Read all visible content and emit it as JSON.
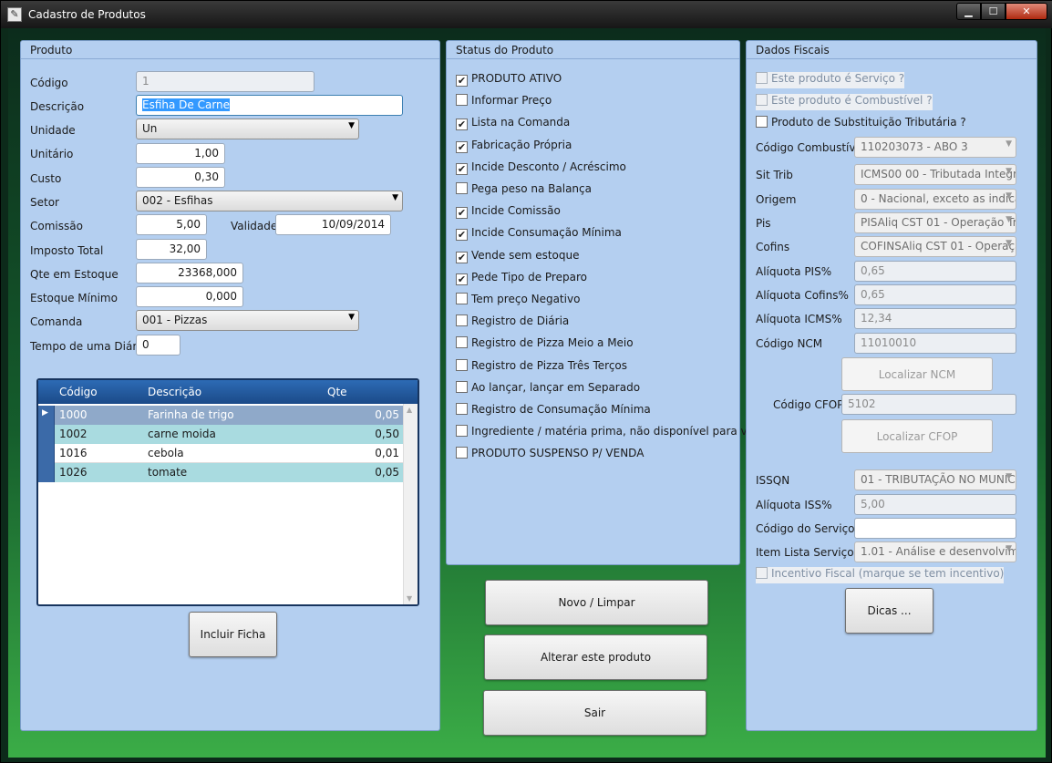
{
  "window": {
    "title": "Cadastro de Produtos",
    "icon": "pencil-icon",
    "controls": {
      "minimize": "▁",
      "maximize": "☐",
      "close": "✕"
    }
  },
  "produto": {
    "section_title": "Produto",
    "codigo": {
      "label": "Código",
      "value": "1"
    },
    "descricao": {
      "label": "Descrição",
      "value": "Esfiha De Carne"
    },
    "unidade": {
      "label": "Unidade",
      "value": "Un"
    },
    "unitario": {
      "label": "Unitário",
      "value": "1,00"
    },
    "custo": {
      "label": "Custo",
      "value": "0,30"
    },
    "setor": {
      "label": "Setor",
      "value": "002 - Esfihas"
    },
    "comissao": {
      "label": "Comissão",
      "value": "5,00"
    },
    "validade": {
      "label": "Validade",
      "value": "10/09/2014"
    },
    "imposto_total": {
      "label": "Imposto Total",
      "value": "32,00"
    },
    "qte_estoque": {
      "label": "Qte em Estoque",
      "value": "23368,000"
    },
    "estoque_minimo": {
      "label": "Estoque Mínimo",
      "value": "0,000"
    },
    "comanda": {
      "label": "Comanda",
      "value": "001 - Pizzas"
    },
    "tempo_diaria": {
      "label": "Tempo de uma Diária",
      "value": "0"
    },
    "ficha": {
      "columns": [
        "Código",
        "Descrição",
        "Qte"
      ],
      "rows": [
        {
          "codigo": "1000",
          "descricao": "Farinha de trigo",
          "qte": "0,05"
        },
        {
          "codigo": "1002",
          "descricao": "carne moida",
          "qte": "0,50"
        },
        {
          "codigo": "1016",
          "descricao": "cebola",
          "qte": "0,01"
        },
        {
          "codigo": "1026",
          "descricao": "tomate",
          "qte": "0,05"
        }
      ]
    },
    "incluir_ficha_label": "Incluir Ficha"
  },
  "status": {
    "section_title": "Status do Produto",
    "items": [
      {
        "label": "PRODUTO ATIVO",
        "checked": true
      },
      {
        "label": "Informar Preço",
        "checked": false
      },
      {
        "label": "Lista na Comanda",
        "checked": true
      },
      {
        "label": "Fabricação Própria",
        "checked": true
      },
      {
        "label": "Incide Desconto / Acréscimo",
        "checked": true
      },
      {
        "label": "Pega peso na Balança",
        "checked": false
      },
      {
        "label": "Incide Comissão",
        "checked": true
      },
      {
        "label": "Incide Consumação Mínima",
        "checked": true
      },
      {
        "label": "Vende sem estoque",
        "checked": true
      },
      {
        "label": "Pede Tipo de Preparo",
        "checked": true
      },
      {
        "label": "Tem preço Negativo",
        "checked": false
      },
      {
        "label": "Registro de Diária",
        "checked": false
      },
      {
        "label": "Registro de Pizza Meio a Meio",
        "checked": false
      },
      {
        "label": "Registro de Pizza Três Terços",
        "checked": false
      },
      {
        "label": "Ao lançar, lançar em Separado",
        "checked": false
      },
      {
        "label": "Registro de Consumação Mínima",
        "checked": false
      },
      {
        "label": "Ingrediente / matéria prima, não disponível para venda",
        "checked": false
      },
      {
        "label": "PRODUTO SUSPENSO P/ VENDA",
        "checked": false
      }
    ]
  },
  "actions": {
    "novo_label": "Novo / Limpar",
    "alterar_label": "Alterar este produto",
    "sair_label": "Sair"
  },
  "fiscal": {
    "section_title": "Dados Fiscais",
    "servico_label": "Este produto é Serviço ?",
    "combustivel_label": "Este produto é Combustível ?",
    "subst_label": "Produto de Substituição Tributária ?",
    "cod_combustivel": {
      "label": "Código Combustível",
      "value": "110203073 - ABO 3"
    },
    "sit_trib": {
      "label": "Sit Trib",
      "value": "ICMS00 00 - Tributada Integr"
    },
    "origem": {
      "label": "Origem",
      "value": "0 - Nacional, exceto as indica"
    },
    "pis": {
      "label": "Pis",
      "value": "PISAliq CST 01 - Operação Tri"
    },
    "cofins": {
      "label": "Cofins",
      "value": "COFINSAliq CST 01 - Operaçã"
    },
    "aliq_pis": {
      "label": "Alíquota PIS%",
      "value": "0,65"
    },
    "aliq_cofins": {
      "label": "Alíquota Cofins%",
      "value": "0,65"
    },
    "aliq_icms": {
      "label": "Alíquota ICMS%",
      "value": "12,34"
    },
    "ncm": {
      "label": "Código NCM",
      "value": "11010010"
    },
    "localizar_ncm_label": "Localizar NCM",
    "cfop": {
      "label": "Código CFOP",
      "value": "5102"
    },
    "localizar_cfop_label": "Localizar CFOP",
    "issqn": {
      "label": "ISSQN",
      "value": "01 - TRIBUTAÇÃO NO MUNIC"
    },
    "aliq_iss": {
      "label": "Alíquota ISS%",
      "value": "5,00"
    },
    "cod_servico": {
      "label": "Código do Serviço",
      "value": ""
    },
    "item_lista": {
      "label": "Item Lista Serviço",
      "value": "1.01 - Análise e desenvolvime"
    },
    "incentivo_label": "Incentivo Fiscal (marque se tem incentivo)",
    "dicas_label": "Dicas ..."
  }
}
